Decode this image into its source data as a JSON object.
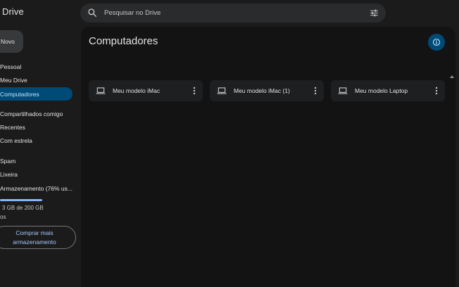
{
  "app": {
    "title": "Drive"
  },
  "search": {
    "placeholder": "Pesquisar no Drive"
  },
  "sidebar": {
    "new_label": "Novo",
    "items": [
      {
        "label": "Pessoal"
      },
      {
        "label": "Meu Drive"
      },
      {
        "label": "Computadores",
        "active": true
      },
      {
        "label": "Compartilhados comigo"
      },
      {
        "label": "Recentes"
      },
      {
        "label": "Com estrela"
      },
      {
        "label": "Spam"
      },
      {
        "label": "Lixeira"
      },
      {
        "label": "Armazenamento (76% us..."
      }
    ],
    "storage": {
      "used_text": "3 GB de 200 GB",
      "sub_text": "os",
      "percent_used": 76
    },
    "buy_label": "Comprar mais armazenamento"
  },
  "main": {
    "title": "Computadores",
    "computers": [
      {
        "name": "Meu modelo iMac"
      },
      {
        "name": "Meu modelo iMac (1)"
      },
      {
        "name": "Meu modelo Laptop"
      }
    ]
  },
  "colors": {
    "background": "#1b1b1b",
    "panel": "#131314",
    "accent": "#004a77",
    "accent_text": "#c2e7ff",
    "link": "#a8c7fa"
  },
  "icons": [
    "search-icon",
    "filter-icon",
    "info-icon",
    "laptop-icon",
    "more-vert-icon"
  ]
}
